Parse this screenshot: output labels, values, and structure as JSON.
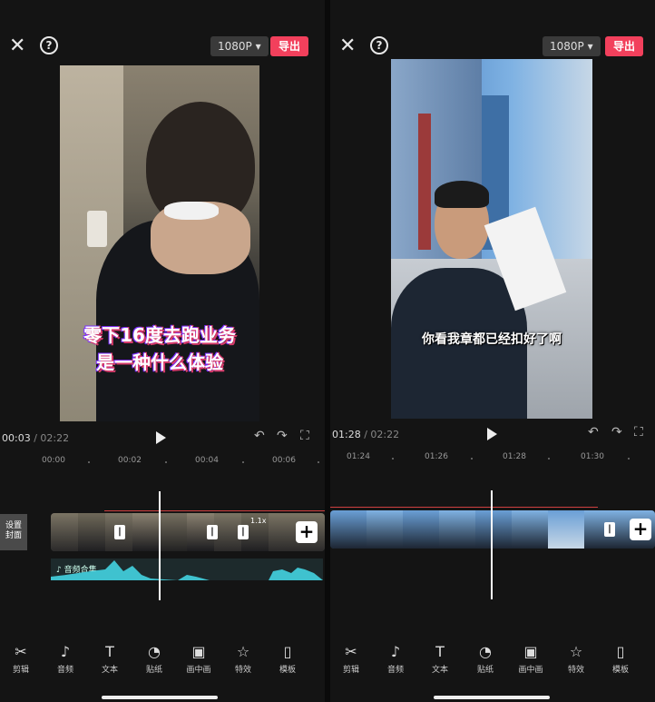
{
  "left": {
    "resolution": "1080P",
    "export_label": "导出",
    "caption_line1": "零下16度去跑业务",
    "caption_line2": "是一种什么体验",
    "time_current": "00:03",
    "time_separator": " / ",
    "time_total": "02:22",
    "ruler": [
      "00:00",
      "00:02",
      "00:04",
      "00:06"
    ],
    "clip_speed": "1.1x",
    "stub_label": "设置\n封面",
    "audio_label": "音频合集"
  },
  "right": {
    "resolution": "1080P",
    "export_label": "导出",
    "caption": "你看我章都已经扣好了啊",
    "time_current": "01:28",
    "time_separator": " / ",
    "time_total": "02:22",
    "ruler": [
      "01:24",
      "01:26",
      "01:28",
      "01:30"
    ]
  },
  "toolbar": [
    {
      "icon": "scissors-icon",
      "label": "剪辑"
    },
    {
      "icon": "music-icon",
      "label": "音频"
    },
    {
      "icon": "text-icon",
      "label": "文本"
    },
    {
      "icon": "sticker-icon",
      "label": "贴纸"
    },
    {
      "icon": "pip-icon",
      "label": "画中画"
    },
    {
      "icon": "effects-icon",
      "label": "特效"
    },
    {
      "icon": "template-icon",
      "label": "模板"
    }
  ],
  "colors": {
    "export": "#f2405c",
    "audio_wave": "#3fc2cf",
    "background": "#141414"
  }
}
